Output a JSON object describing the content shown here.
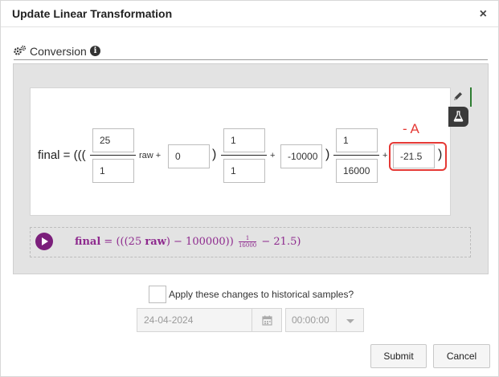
{
  "dialog": {
    "title": "Update Linear Transformation",
    "close_glyph": "×"
  },
  "section": {
    "label": "Conversion",
    "icon": "gears-icon",
    "info_icon": "info-circle-icon",
    "info_glyph": "i"
  },
  "formula": {
    "prefix": "final = (((",
    "raw_label": "raw +",
    "plus_1": "+",
    "plus_2": "+",
    "close_paren": ")",
    "numerator_1": "25",
    "denominator_1": "1",
    "offset_1": "0",
    "numerator_2": "1",
    "denominator_2": "1",
    "offset_2": "-10000",
    "numerator_3": "1",
    "denominator_3": "16000",
    "offset_3": "-21.5"
  },
  "annotation": {
    "label": "- A",
    "color": "#e53935"
  },
  "tools": {
    "edit_icon": "pencil-icon",
    "test_icon": "flask-icon"
  },
  "preview": {
    "play_icon": "play-icon",
    "lhs": "final",
    "equals": "=",
    "body_start": "(((25",
    "raw": "raw",
    "body_mid": ") − 100000))",
    "frac_num": "1",
    "frac_den": "16000",
    "tail": "− 21.5)",
    "color": "#8e2a8e"
  },
  "history": {
    "apply_label": "Apply these changes to historical samples?",
    "checked": false,
    "date_value": "24-04-2024",
    "calendar_icon": "calendar-icon",
    "time_value": "00:00:00",
    "time_dropdown_icon": "chevron-down-icon"
  },
  "buttons": {
    "submit": "Submit",
    "cancel": "Cancel"
  }
}
